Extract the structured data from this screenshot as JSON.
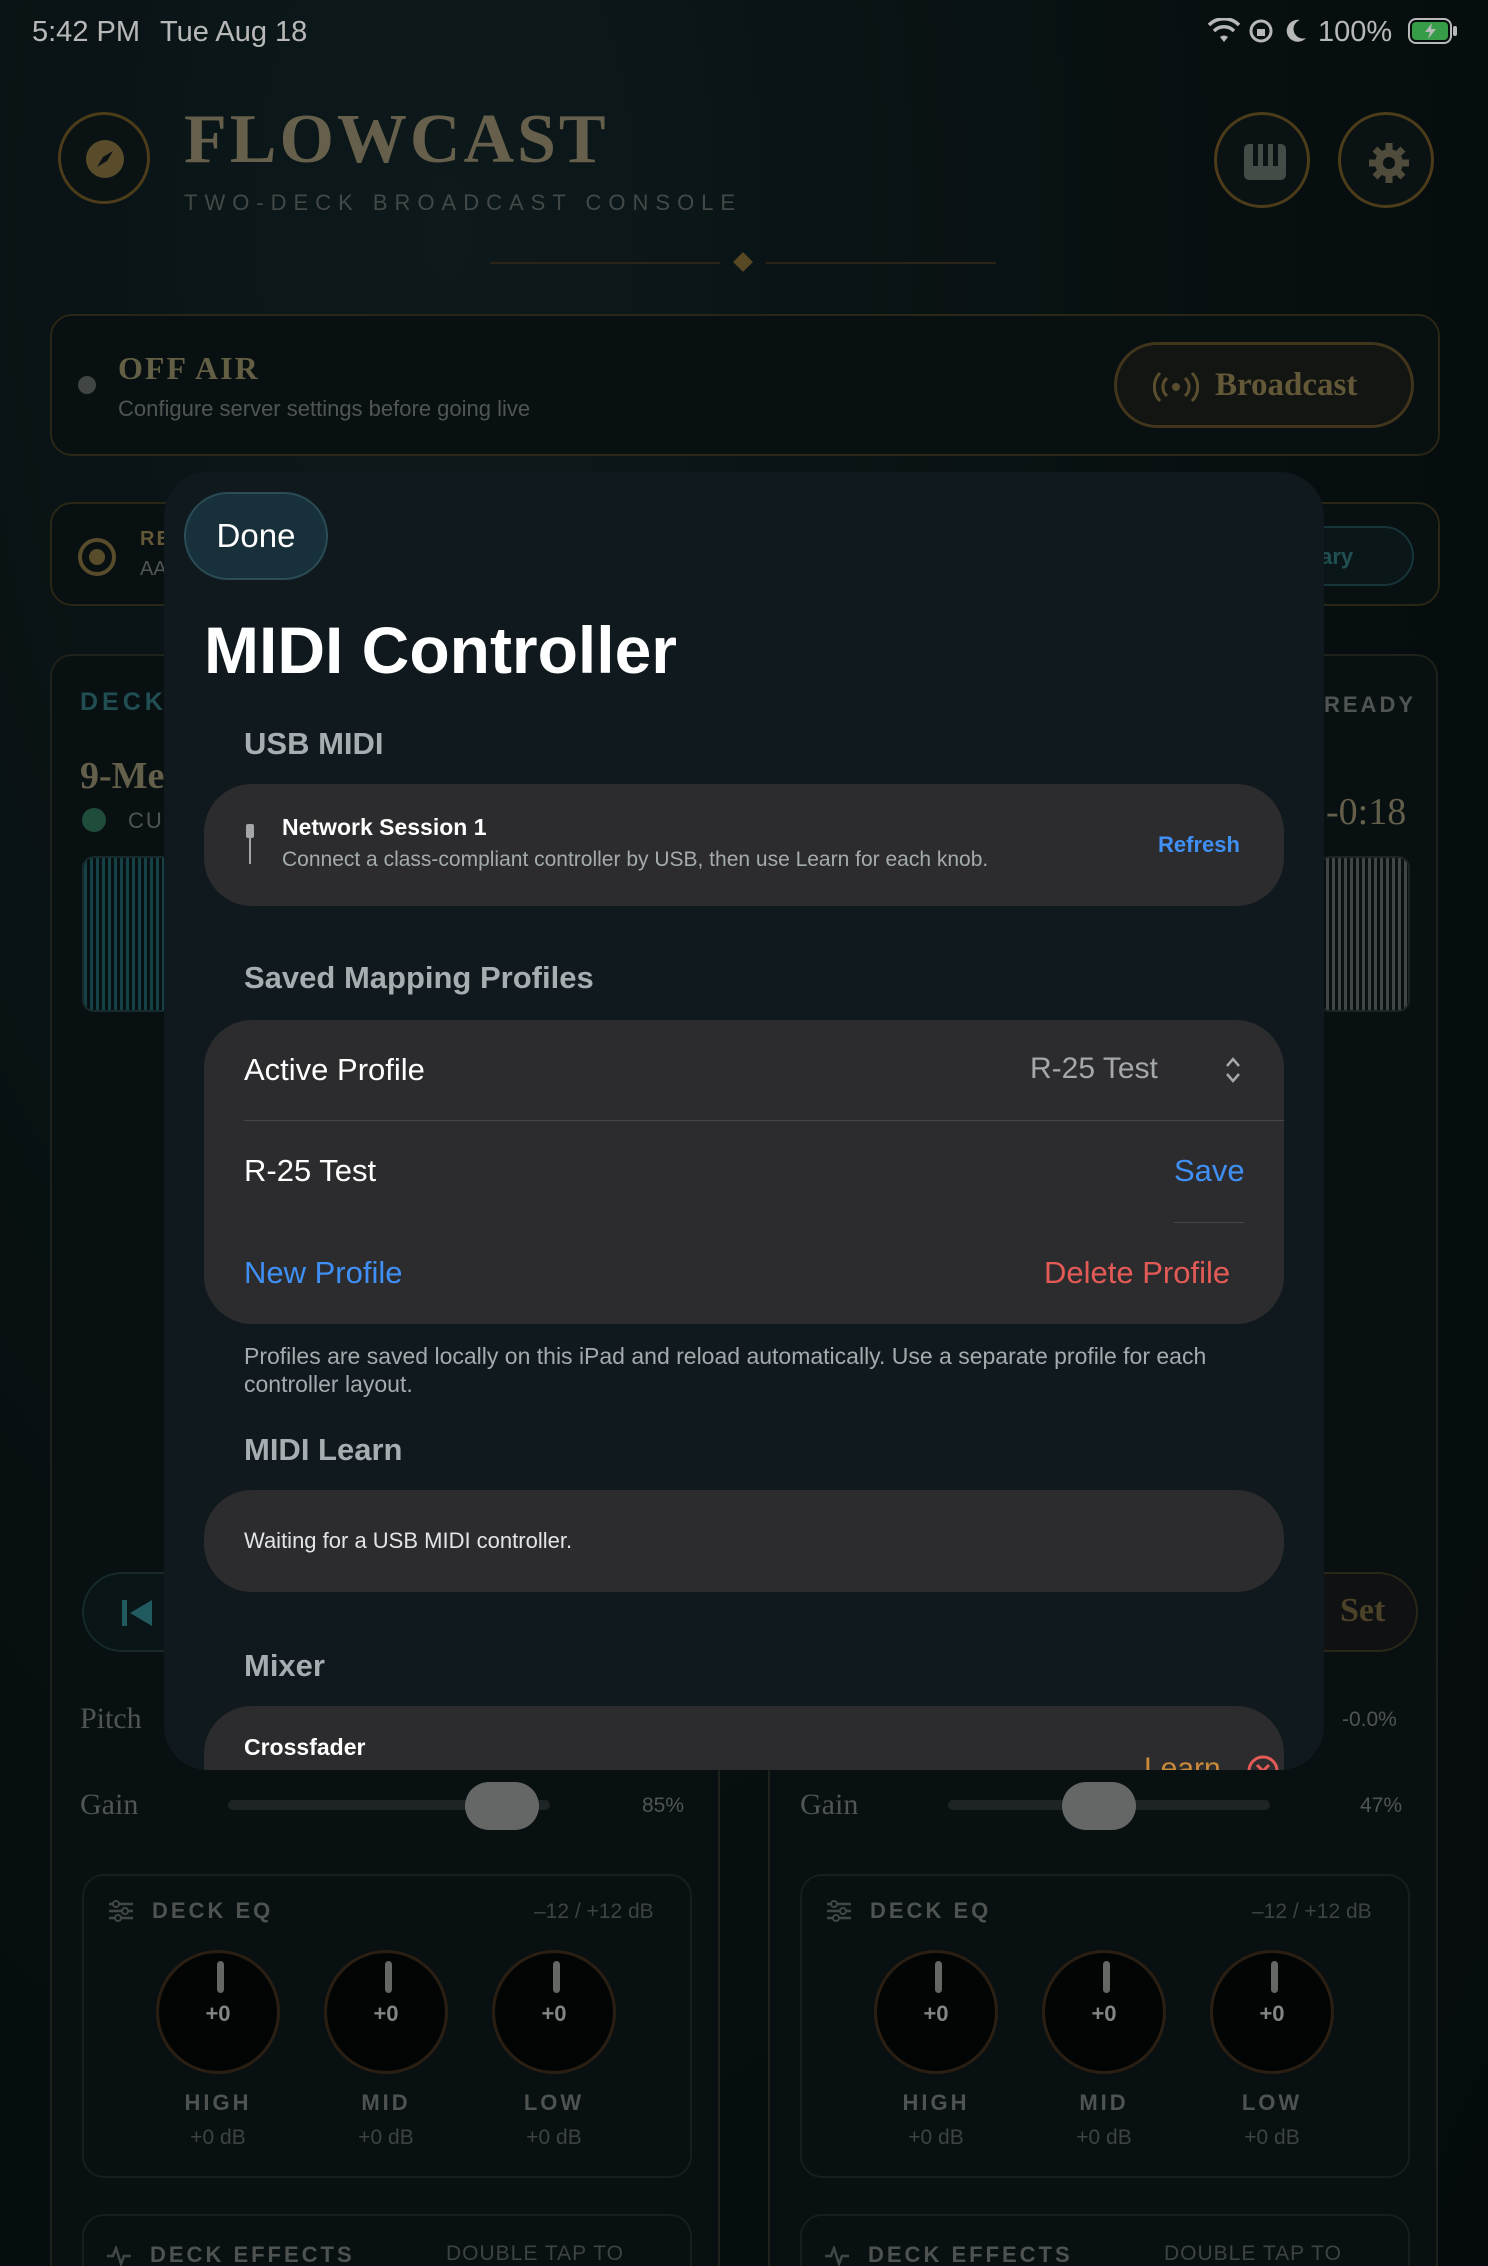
{
  "status_bar": {
    "time": "5:42 PM",
    "date": "Tue Aug 18",
    "battery": "100%"
  },
  "app": {
    "brand_title": "FLOWCAST",
    "brand_subtitle": "TWO-DECK BROADCAST CONSOLE",
    "air_status": {
      "title": "OFF AIR",
      "subtitle": "Configure server settings before going live",
      "broadcast_label": "Broadcast"
    },
    "recorder_partial": {
      "label_fragment": "RE",
      "sub_fragment": "AA",
      "library_label": "ibrary"
    },
    "deck_a": {
      "header_fragment": "DECK",
      "track_fragment": "9-Me",
      "cue_fragment": "CUE",
      "pitch_label": "Pitch",
      "gain_label": "Gain",
      "gain_value": "85%",
      "gain_fraction": 0.85,
      "eq": {
        "title": "DECK EQ",
        "range": "–12 / +12 dB",
        "knobs": [
          {
            "value": "+0",
            "label": "HIGH",
            "db": "+0 dB"
          },
          {
            "value": "+0",
            "label": "MID",
            "db": "+0 dB"
          },
          {
            "value": "+0",
            "label": "LOW",
            "db": "+0 dB"
          }
        ]
      },
      "effects": {
        "title": "DECK EFFECTS",
        "hint": "DOUBLE TAP TO RESET"
      }
    },
    "deck_b": {
      "ready_fragment": "READY",
      "time_fragment": "-0:18",
      "set_fragment": "Set",
      "pitch_value": "-0.0%",
      "gain_label": "Gain",
      "gain_value": "47%",
      "gain_fraction": 0.47,
      "eq": {
        "title": "DECK EQ",
        "range": "–12 / +12 dB",
        "knobs": [
          {
            "value": "+0",
            "label": "HIGH",
            "db": "+0 dB"
          },
          {
            "value": "+0",
            "label": "MID",
            "db": "+0 dB"
          },
          {
            "value": "+0",
            "label": "LOW",
            "db": "+0 dB"
          }
        ]
      },
      "effects": {
        "title": "DECK EFFECTS",
        "hint": "DOUBLE TAP TO RESET"
      }
    }
  },
  "sheet": {
    "done_label": "Done",
    "title": "MIDI Controller",
    "usb_section": {
      "header": "USB MIDI",
      "device_name": "Network Session 1",
      "device_hint": "Connect a class-compliant controller by USB, then use Learn for each knob.",
      "refresh_label": "Refresh"
    },
    "profiles_section": {
      "header": "Saved Mapping Profiles",
      "active_label": "Active Profile",
      "active_value": "R-25 Test",
      "name_field_value": "R-25 Test",
      "save_label": "Save",
      "new_label": "New Profile",
      "delete_label": "Delete Profile",
      "footnote": "Profiles are saved locally on this iPad and reload automatically. Use a separate profile for each controller layout."
    },
    "learn_section": {
      "header": "MIDI Learn",
      "status": "Waiting for a USB MIDI controller."
    },
    "mixer_section": {
      "header": "Mixer",
      "row_label": "Crossfader",
      "learn_label": "Learn"
    }
  }
}
